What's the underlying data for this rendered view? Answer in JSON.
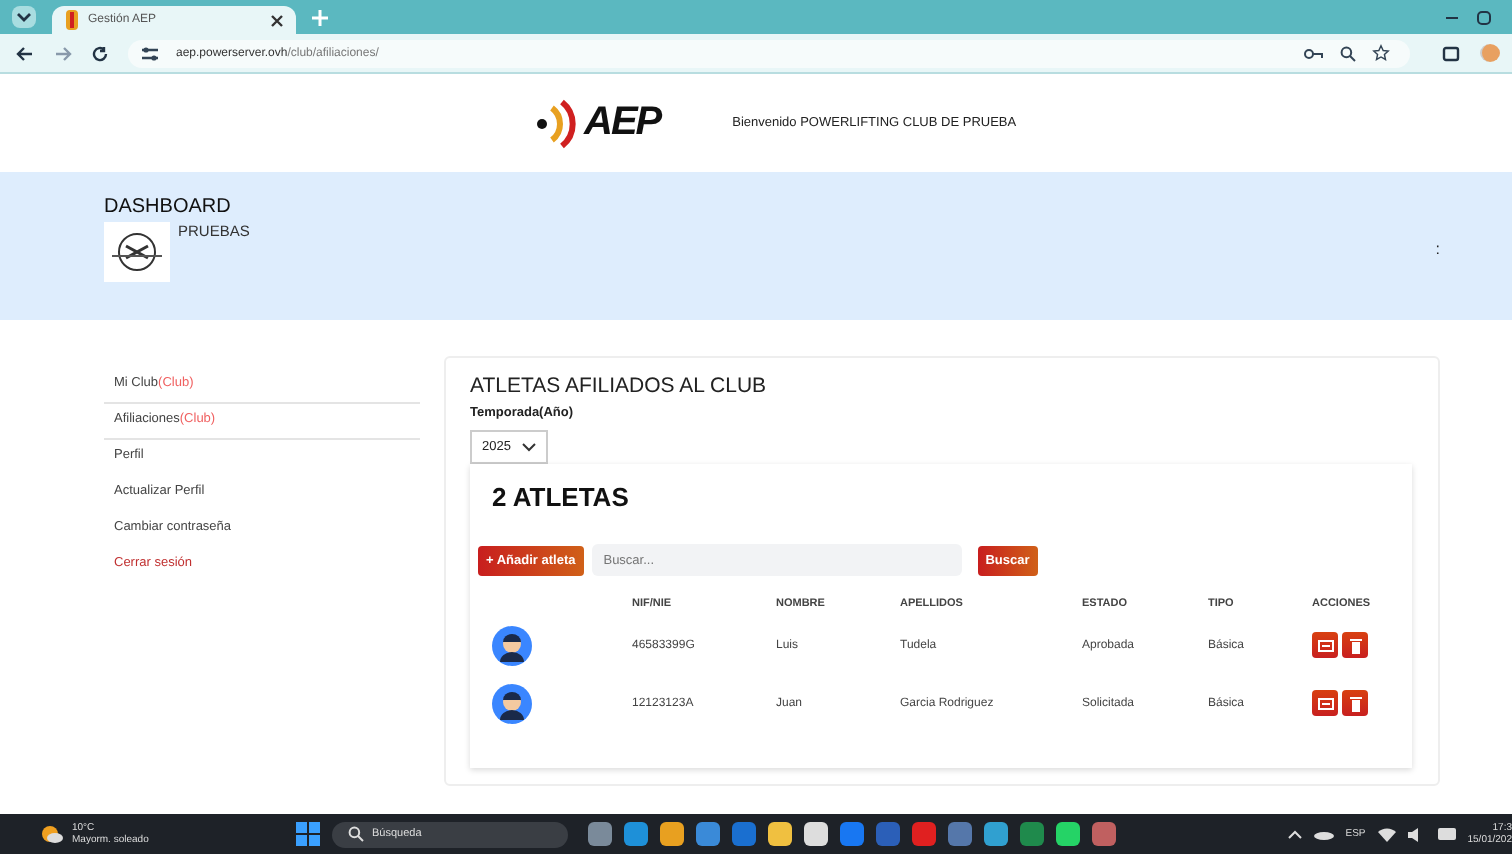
{
  "browser": {
    "tab_title": "Gestión AEP",
    "url_host": "aep.powerserver.ovh",
    "url_path": "/club/afiliaciones/"
  },
  "header": {
    "logo_text": "AEP",
    "welcome": "Bienvenido POWERLIFTING CLUB DE PRUEBA"
  },
  "dashboard": {
    "title": "DASHBOARD",
    "club_name": "PRUEBAS",
    "menu_glyph": ":"
  },
  "sidebar": {
    "items": [
      {
        "label": "Mi Club",
        "tag": "(Club)",
        "kind": "link"
      },
      {
        "label": "Afiliaciones",
        "tag": "(Club)",
        "kind": "link"
      },
      {
        "label": "Perfil",
        "kind": "link"
      },
      {
        "label": "Actualizar Perfil",
        "kind": "link"
      },
      {
        "label": "Cambiar contraseña",
        "kind": "link"
      },
      {
        "label": "Cerrar sesión",
        "kind": "logout"
      }
    ]
  },
  "main": {
    "title": "ATLETAS AFILIADOS AL CLUB",
    "season_label": "Temporada(Año)",
    "season_value": "2025",
    "count_title": "2 ATLETAS",
    "add_button": "+ Añadir atleta",
    "search": {
      "placeholder": "Buscar..."
    },
    "search_button": "Buscar",
    "table": {
      "columns": [
        "NIF/NIE",
        "NOMBRE",
        "APELLIDOS",
        "ESTADO",
        "TIPO",
        "ACCIONES"
      ],
      "rows": [
        {
          "nif": "46583399G",
          "nombre": "Luis",
          "apellidos": "Tudela",
          "estado": "Aprobada",
          "tipo": "Básica"
        },
        {
          "nif": "12123123A",
          "nombre": "Juan",
          "apellidos": "Garcia Rodriguez",
          "estado": "Solicitada",
          "tipo": "Básica"
        }
      ]
    }
  },
  "taskbar": {
    "weather_temp": "10°C",
    "weather_text": "Mayorm. soleado",
    "search": "Búsqueda",
    "language": "ESP",
    "time": "17:3",
    "date": "15/01/202"
  }
}
